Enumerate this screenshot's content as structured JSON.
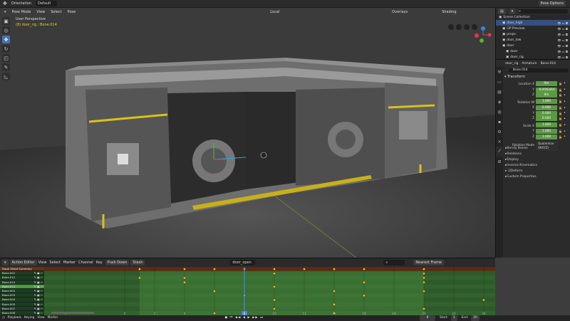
{
  "topbar": {
    "orientation_label": "Orientation",
    "orientation_value": "Default",
    "pose_options": "Pose Options"
  },
  "viewport": {
    "mode": "Pose Mode",
    "menus": [
      "View",
      "Select",
      "Pose"
    ],
    "transform_space": "Local",
    "overlays": "Overlays",
    "shading": "Shading",
    "view_name": "User Perspective",
    "active_info": "(8) door_rig : Bone.014"
  },
  "tools": [
    "select-icon",
    "cursor-icon",
    "move-icon",
    "rotate-icon",
    "scale-icon",
    "transform-icon",
    "annotate-icon",
    "measure-icon"
  ],
  "outliner": {
    "items": [
      {
        "label": "Scene Collection",
        "indent": 0
      },
      {
        "label": "door_high",
        "indent": 1,
        "selected": true
      },
      {
        "label": "GP Preview",
        "indent": 1
      },
      {
        "label": "props",
        "indent": 1
      },
      {
        "label": "door_low",
        "indent": 1
      },
      {
        "label": "door",
        "indent": 1
      },
      {
        "label": "door",
        "indent": 2
      },
      {
        "label": "door_rig",
        "indent": 2
      }
    ]
  },
  "properties": {
    "breadcrumb": [
      "door_rig",
      "Armature",
      "Bone.014"
    ],
    "bone_name": "Bone.014",
    "transform_label": "Transform",
    "location": {
      "label": "Location X",
      "x": "0m",
      "y": "-0.45634m",
      "z": "0m"
    },
    "rotation": {
      "label": "Rotation W",
      "w": "1.000",
      "x": "0.000",
      "y": "0.000",
      "z": "0.000"
    },
    "scale": {
      "label": "Scale X",
      "x": "1.000",
      "y": "1.000",
      "z": "1.000"
    },
    "axis": {
      "x": "X",
      "y": "Y",
      "z": "Z"
    },
    "rotation_mode_label": "Rotation Mode",
    "rotation_mode": "Quaternion (WXYZ)",
    "panels": [
      "Bendy Bones",
      "Relations",
      "Display",
      "Inverse Kinematics",
      "Deform",
      "Custom Properties"
    ]
  },
  "dopesheet": {
    "mode": "Action Editor",
    "menus": [
      "View",
      "Select",
      "Marker",
      "Channel",
      "Key"
    ],
    "push_down": "Push Down",
    "stash": "Stash",
    "action": "door_open",
    "snap": "Nearest Frame",
    "channels": [
      "Dope Sheet Summary",
      "Bone.001",
      "Bone.012",
      "Bone.014",
      "Bone.013",
      "Bone.002",
      "Bone.003",
      "Bone.004",
      "Bone.005",
      "Bone.007",
      "Bone.008"
    ],
    "active_channel": 4,
    "frame_ticks": [
      -4,
      0,
      2,
      4,
      6,
      8,
      10,
      12,
      14,
      16,
      18,
      20,
      22,
      24
    ],
    "current_frame": 8,
    "keys": [
      [
        1,
        4,
        6,
        8,
        10,
        12,
        14,
        16,
        20
      ],
      [
        10,
        20
      ],
      [
        1,
        4,
        20
      ],
      [
        4,
        16,
        20
      ],
      [
        10
      ],
      [
        6,
        14,
        20
      ],
      [
        8,
        16
      ],
      [
        10,
        24
      ],
      [
        14
      ],
      [
        10,
        20
      ],
      [
        6,
        8,
        14
      ]
    ]
  },
  "timeline": {
    "menus": [
      "Playback",
      "Keying",
      "View",
      "Marker"
    ],
    "current": "8",
    "start_label": "Start:",
    "start": "1",
    "end_label": "End:",
    "end": "20"
  }
}
